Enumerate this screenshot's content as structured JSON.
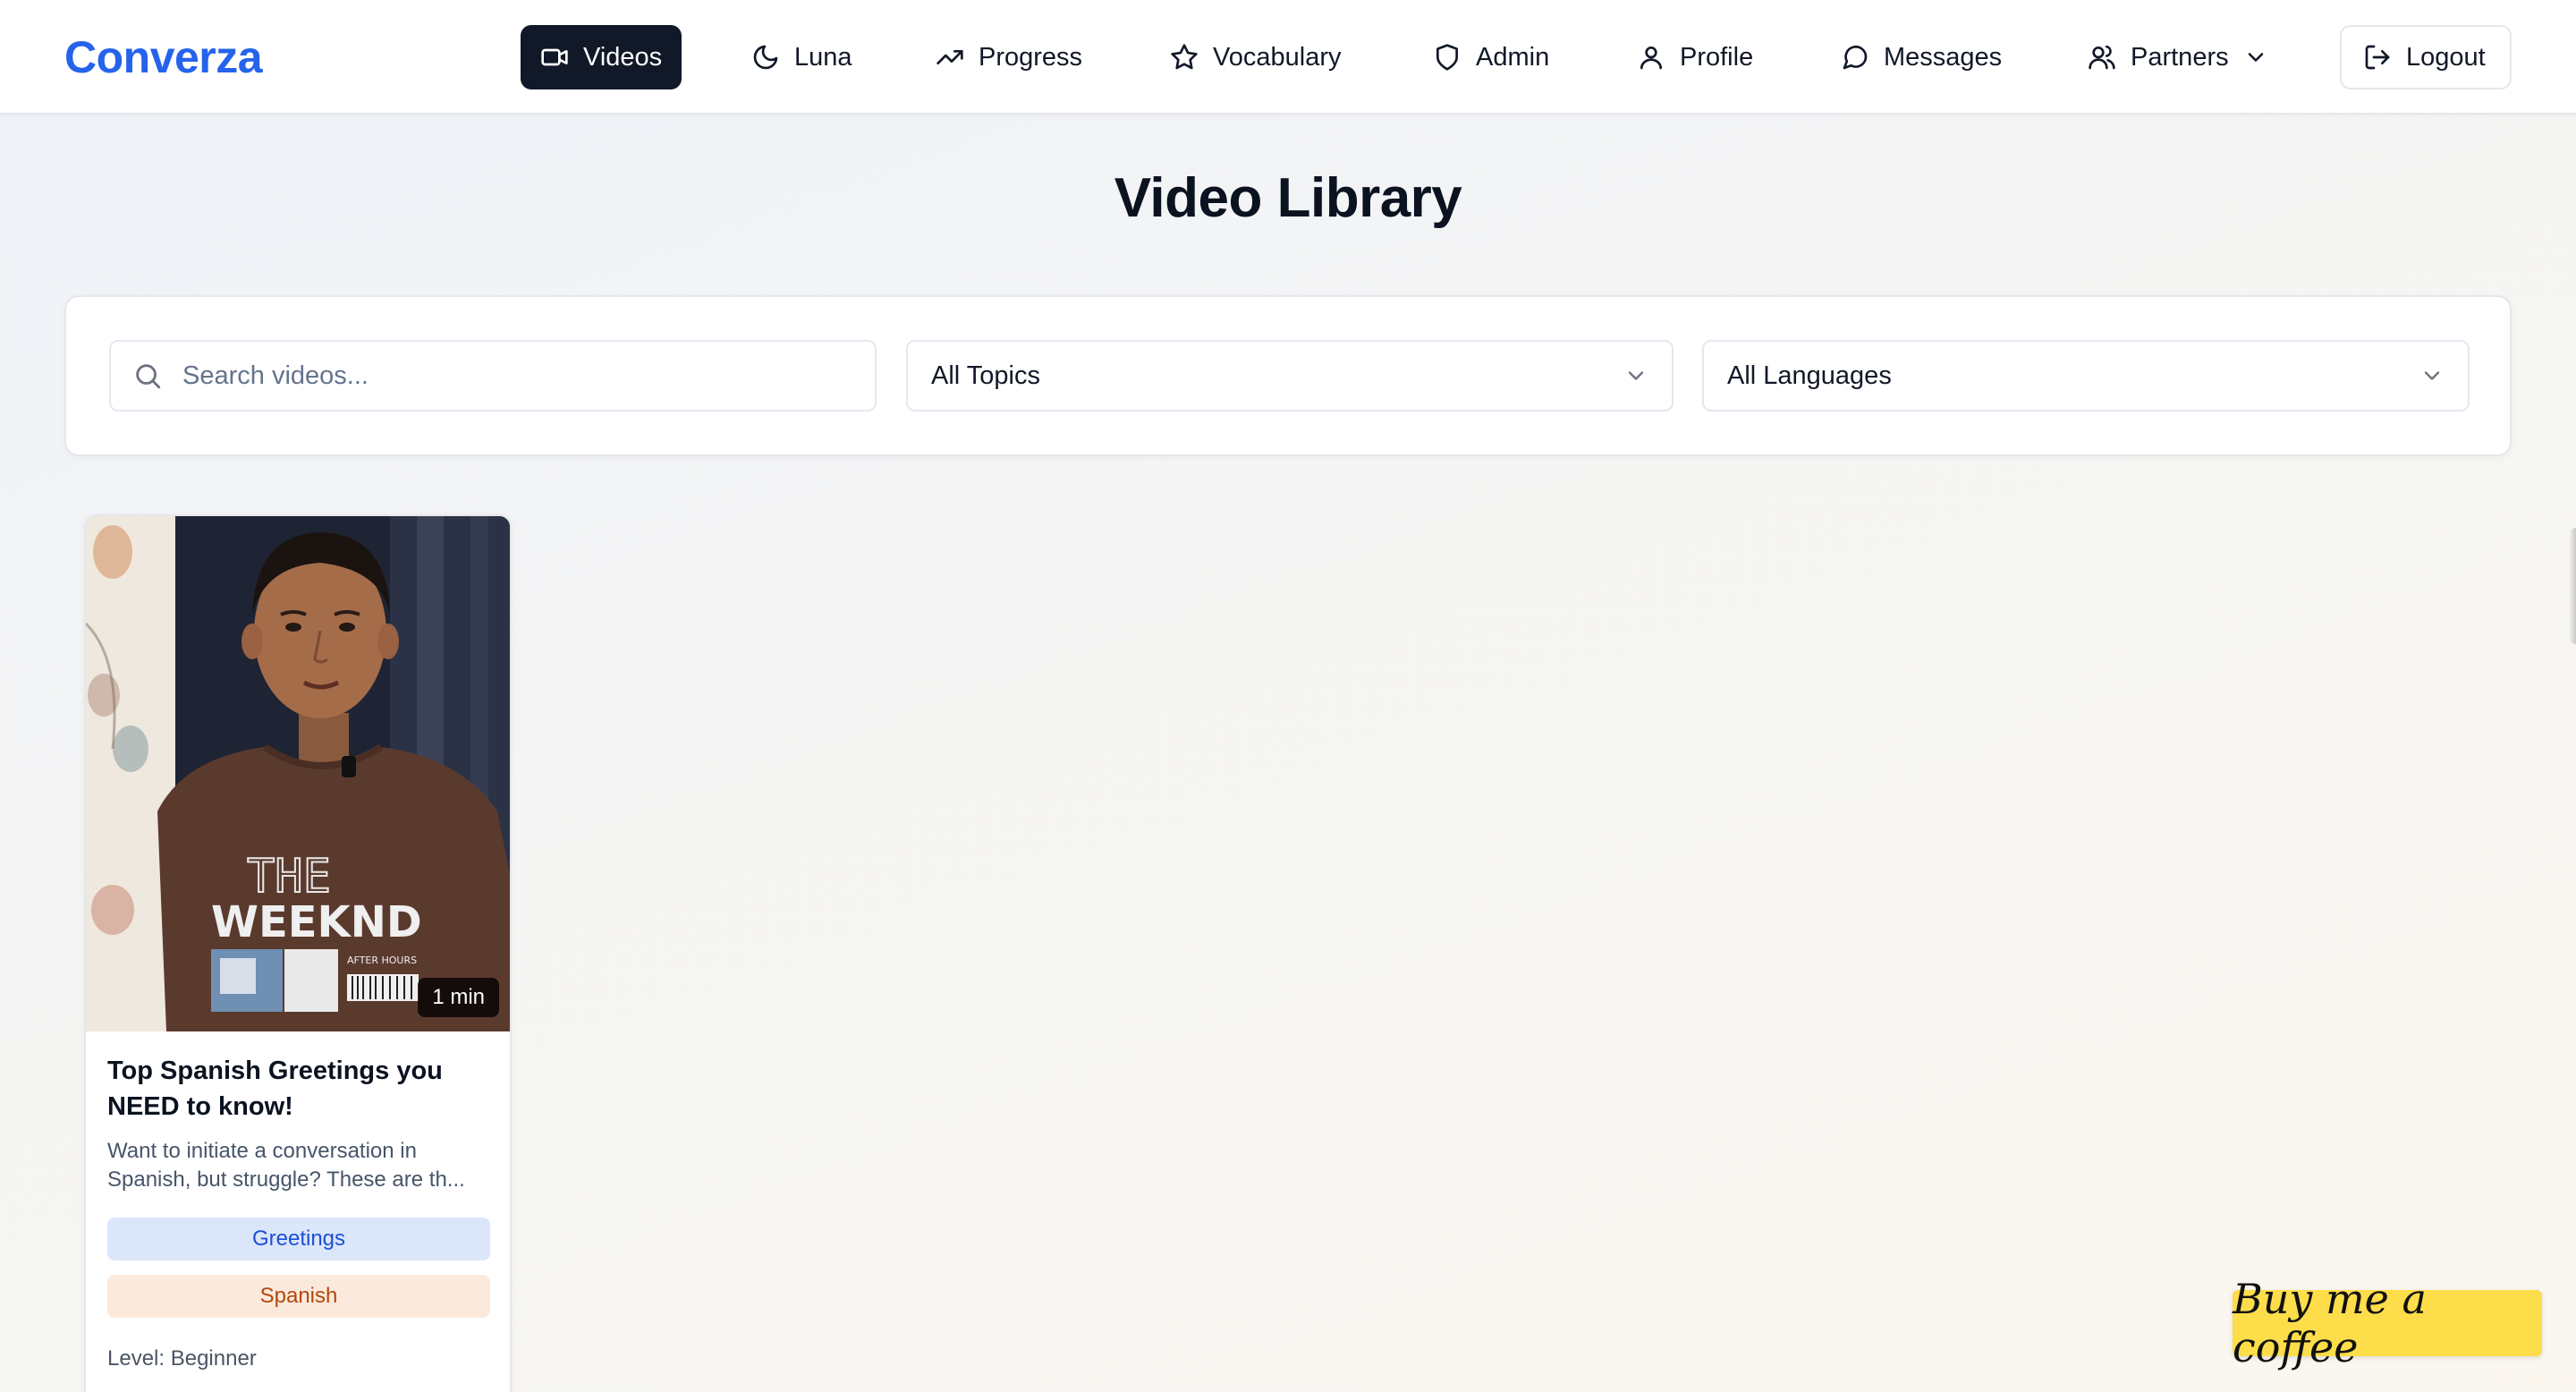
{
  "app": {
    "brand": "Converza"
  },
  "nav": {
    "videos": "Videos",
    "luna": "Luna",
    "progress": "Progress",
    "vocabulary": "Vocabulary",
    "admin": "Admin",
    "profile": "Profile",
    "messages": "Messages",
    "partners": "Partners",
    "logout": "Logout",
    "active": "Videos"
  },
  "page": {
    "title": "Video Library"
  },
  "filters": {
    "search_placeholder": "Search videos...",
    "search_value": "",
    "topic_selected": "All Topics",
    "language_selected": "All Languages"
  },
  "videos": [
    {
      "title": "Top Spanish Greetings you NEED to know!",
      "description_line1": "Want to initiate a conversation in",
      "description_line2": "Spanish, but struggle? These are th...",
      "duration": "1 min",
      "topic": "Greetings",
      "language": "Spanish",
      "level": "Level: Beginner",
      "shirt_print_line1": "THE",
      "shirt_print_line2": "WEEKND",
      "shirt_print_small": "AFTER HOURS"
    }
  ],
  "support": {
    "coffee_label": "Buy me a coffee"
  },
  "colors": {
    "brand": "#2563eb",
    "active_nav_bg": "#111827",
    "topic_tag_bg": "#dbe6fb",
    "topic_tag_text": "#1d4ed8",
    "language_tag_bg": "#fbeadb",
    "language_tag_text": "#b4470c",
    "coffee_bg": "#fddd4a"
  },
  "icons": {
    "videos": "video-camera-icon",
    "luna": "moon-icon",
    "progress": "trending-up-icon",
    "vocabulary": "star-icon",
    "admin": "shield-icon",
    "profile": "user-icon",
    "messages": "message-circle-icon",
    "partners": "users-icon",
    "partners_caret": "chevron-down-icon",
    "logout": "log-out-icon",
    "search": "search-icon",
    "select_caret": "chevron-down-icon"
  }
}
